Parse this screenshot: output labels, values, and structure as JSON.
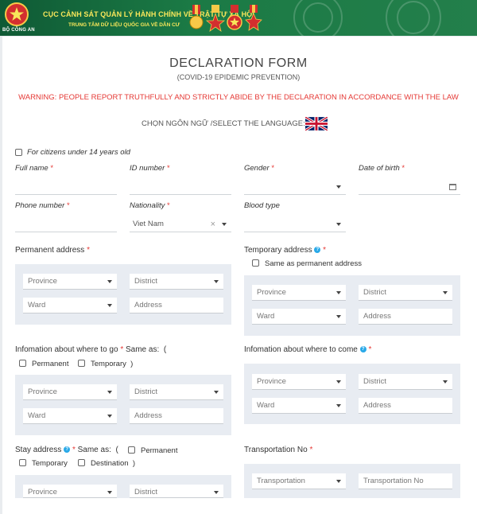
{
  "header": {
    "title": "CỤC CẢNH SÁT QUẢN LÝ HÀNH CHÍNH VỀ TRẬT TỰ XÃ HỘI",
    "subtitle": "TRUNG TÂM DỮ LIỆU QUỐC GIA VỀ DÂN CƯ",
    "emblem_label": "BỘ CÔNG AN",
    "colors": {
      "bg": "#1b7a45",
      "text": "#f7e65a"
    }
  },
  "form": {
    "title": "DECLARATION FORM",
    "subtitle": "(COVID-19 EPIDEMIC PREVENTION)",
    "warning": "WARNING: PEOPLE REPORT TRUTHFULLY AND STRICTLY ABIDE BY THE DECLARATION IN ACCORDANCE WITH THE LAW",
    "language_label": "CHỌN NGÔN NGỮ /SELECT THE LANGUAGE:",
    "under14_label": "For citizens under 14 years old",
    "required_mark": "*",
    "fields": {
      "full_name": "Full name",
      "id_number": "ID number",
      "gender": "Gender",
      "dob": "Date of birth",
      "phone": "Phone number",
      "nationality": "Nationality",
      "nationality_value": "Viet Nam",
      "blood_type": "Blood type",
      "clear": "×"
    },
    "permanent": {
      "label": "Permanent address"
    },
    "temporary": {
      "label": "Temporary address",
      "same_as_permanent": "Same as permanent address"
    },
    "where_go": {
      "label": "Infomation about where to go",
      "same_as": "Same as:",
      "open_paren": "(",
      "close_paren": ")",
      "opt_permanent": "Permanent",
      "opt_temporary": "Temporary"
    },
    "where_come": {
      "label": "Infomation about where to come"
    },
    "stay": {
      "label": "Stay address",
      "same_as": "Same as:",
      "open_paren": "(",
      "close_paren": ")",
      "opt_permanent": "Permanent",
      "opt_temporary": "Temporary",
      "opt_destination": "Destination"
    },
    "transport": {
      "label": "Transportation No",
      "type_placeholder": "Transportation",
      "no_placeholder": "Transportation No"
    },
    "address_fields": {
      "province": "Province",
      "district": "District",
      "ward": "Ward",
      "address": "Address"
    }
  },
  "colors": {
    "required": "#e53935",
    "panel": "#e8ecf2",
    "info": "#29a9e8"
  }
}
